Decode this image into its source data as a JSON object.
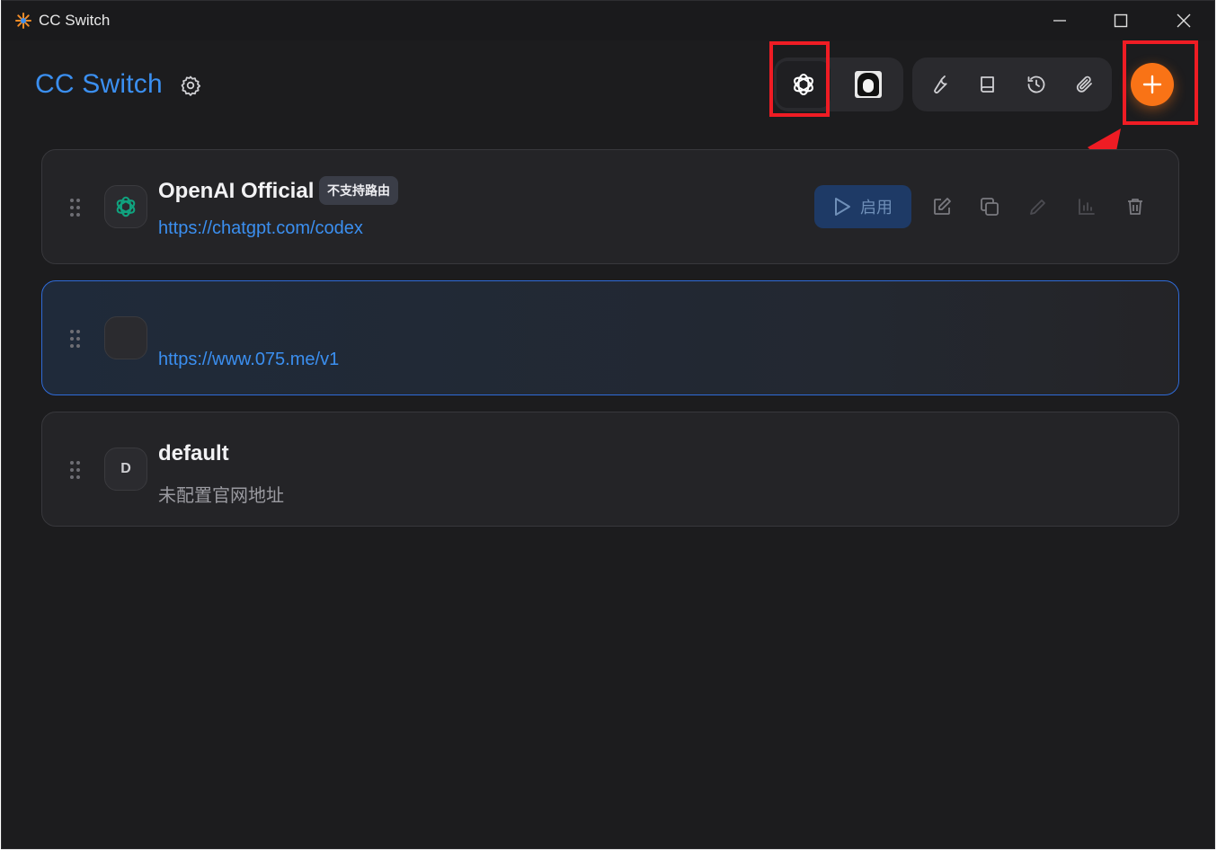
{
  "window": {
    "title": "CC Switch"
  },
  "header": {
    "brand": "CC Switch",
    "apps": [
      {
        "name": "codex",
        "icon": "openai-icon",
        "active": true
      },
      {
        "name": "gemini",
        "icon": "avatar-icon",
        "active": false
      }
    ],
    "tools": [
      "wrench-icon",
      "book-icon",
      "history-icon",
      "paperclip-icon"
    ],
    "add_icon": "plus-icon"
  },
  "providers": [
    {
      "name": "OpenAI Official",
      "badge": "不支持路由",
      "url": "https://chatgpt.com/codex",
      "icon": "openai-icon",
      "enable_label": "启用",
      "active": false
    },
    {
      "name": "",
      "url": "https://www.075.me/v1",
      "icon": "",
      "active": true
    },
    {
      "name": "default",
      "url": "未配置官网地址",
      "icon_letter": "D",
      "active": false
    }
  ],
  "colors": {
    "accent": "#3b8ff0",
    "add_button": "#f97316",
    "highlight": "#ef1c24"
  }
}
